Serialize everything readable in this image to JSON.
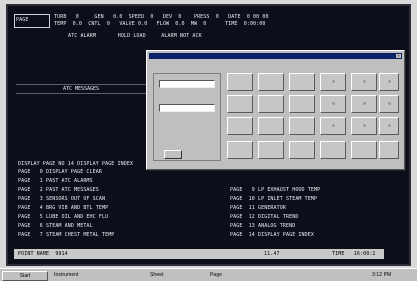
{
  "header": {
    "box_text": "PAGE",
    "row1": "TURB   0     GEN   0.0  SPEED  0   DEV  0    PRESS  0   DATE  0 00 00",
    "row2": "TEMP  0.0  CNTL  0   VALVE 0.0   FLOW  0.0  MW  0      TIME  0:00:00",
    "status_line": "ATC ALARM       HOLD LOAD     ALARM NOT ACK"
  },
  "banner": {
    "label": "ATC MESSAGES"
  },
  "page_menu": {
    "title": "DISPLAY PAGE NO 14 DISPLAY PAGE INDEX",
    "left_items": [
      "PAGE   0 DISPLAY PAGE CLEAR",
      "PAGE   1 PAST ATC ALARMS",
      "PAGE   2 PAST ATC MESSAGES",
      "PAGE   3 SENSORS OUT OF SCAN",
      "PAGE   4 BRG VIB AND BTL TEMP",
      "PAGE   5 LUBE OIL AND EHC FLU",
      "PAGE   6 STEAM AND METAL",
      "PAGE   7 STEAM CHEST METAL TEMP"
    ],
    "right_items": [
      "PAGE   9 LP EXHAUST HOOD TEMP",
      "PAGE  10 LP INLET STEAM TEMP",
      "PAGE  11 GENERATOR",
      "PAGE  12 DIGITAL TREND",
      "PAGE  13 ANALOG TREND",
      "PAGE  14 DISPLAY PAGE INDEX"
    ]
  },
  "statusbar": {
    "point_name": "POINT NAME  9914",
    "value": "11.47",
    "time": "TIME   16:00:2"
  },
  "taskbar": {
    "start": "Start",
    "item1": "Instrument",
    "item2": "Sheet",
    "item3": "Page",
    "clock": "3:12 PM"
  },
  "dialog": {
    "title": "",
    "field1_value": "",
    "field2_label": "",
    "field2_value": "",
    "ok_label": "",
    "grid_labels": [
      "",
      "",
      "",
      "",
      "",
      "",
      "",
      "",
      "",
      "",
      "",
      "",
      "",
      "",
      "",
      "",
      "",
      "",
      "",
      "",
      "",
      "",
      "",
      "",
      ""
    ]
  }
}
